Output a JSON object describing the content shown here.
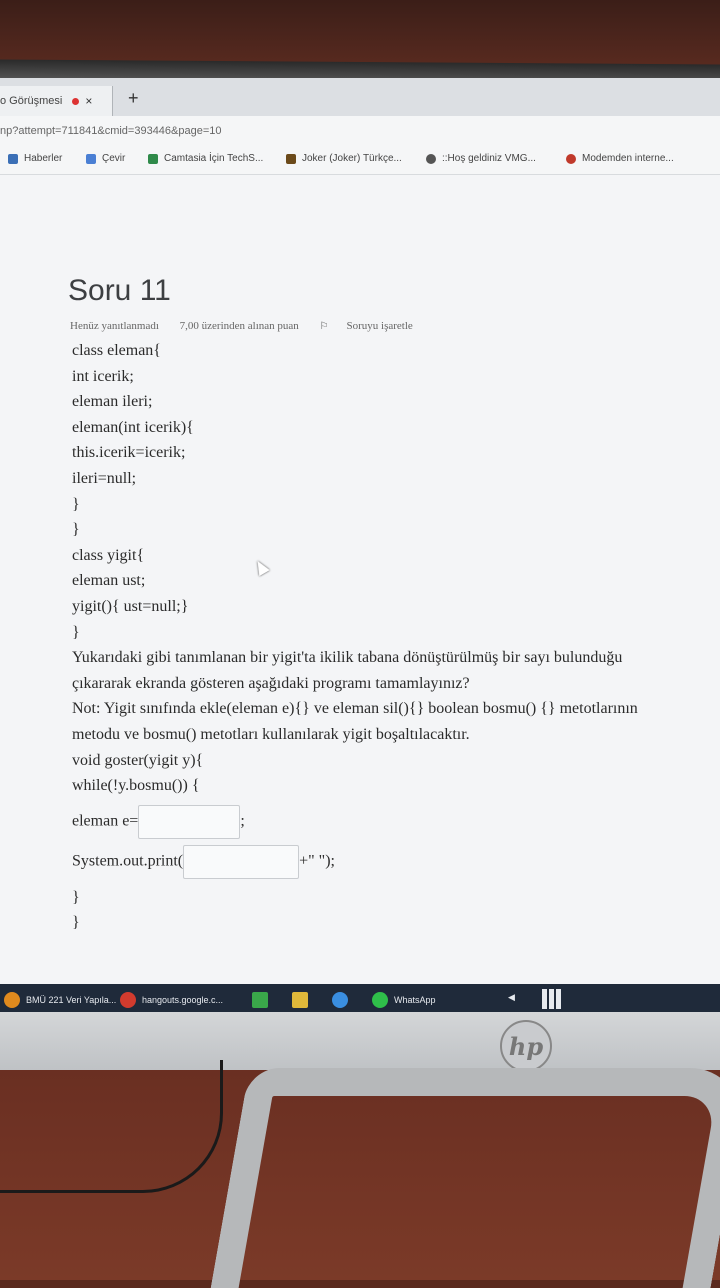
{
  "browser": {
    "tab_title": "o Görüşmesi",
    "tab_close": "×",
    "new_tab": "+",
    "url": "np?attempt=711841&cmid=393446&page=10",
    "bookmarks": [
      {
        "label": "Haberler",
        "icon": "news-icon",
        "color": "#3b6fb6"
      },
      {
        "label": "Çevir",
        "icon": "translate-icon",
        "color": "#4a7fd4"
      },
      {
        "label": "Camtasia İçin TechS...",
        "icon": "camtasia-icon",
        "color": "#2f8a4a"
      },
      {
        "label": "Joker (Joker) Türkçe...",
        "icon": "joker-icon",
        "color": "#6b4a1a"
      },
      {
        "label": "::Hoş geldiniz VMG...",
        "icon": "globe-icon",
        "color": "#555555"
      },
      {
        "label": "Modemden interne...",
        "icon": "chrome-icon",
        "color": "#c0392b"
      }
    ]
  },
  "question": {
    "title": "Soru 11",
    "status": "Henüz yanıtlanmadı",
    "points": "7,00 üzerinden alınan puan",
    "flag_label": "Soruyu işaretle",
    "code_lines": [
      "class eleman{",
      "int icerik;",
      "eleman ileri;",
      "eleman(int icerik){",
      "this.icerik=icerik;",
      "ileri=null;",
      "}",
      "}",
      "class yigit{",
      "eleman ust;",
      "yigit(){ ust=null;}",
      "}",
      "Yukarıdaki gibi tanımlanan bir yigit'ta ikilik tabana dönüştürülmüş bir sayı bulunduğu",
      "çıkararak ekranda gösteren aşağıdaki programı tamamlayınız?",
      "Not: Yigit sınıfında ekle(eleman e){} ve eleman sil(){} boolean bosmu() {} metotlarının",
      "metodu ve bosmu() metotları kullanılarak yigit boşaltılacaktır.",
      "void goster(yigit y){",
      "while(!y.bosmu()) {"
    ],
    "answer1_prefix": "eleman e=",
    "answer1_suffix": ";",
    "answer1_value": "",
    "answer2_prefix": "System.out.print(",
    "answer2_suffix": "+\" \");",
    "answer2_value": "",
    "closing_lines": [
      "}",
      "}"
    ]
  },
  "taskbar": {
    "items": [
      {
        "label": "BMÜ 221 Veri Yapıla...",
        "icon": "app-icon",
        "color": "#e08a1e"
      },
      {
        "label": "hangouts.google.c...",
        "icon": "chrome-icon",
        "color": "#d23b2e"
      },
      {
        "label": "",
        "icon": "camtasia-icon",
        "color": "#3aa84a"
      },
      {
        "label": "",
        "icon": "app-z-icon",
        "color": "#e0b83a"
      },
      {
        "label": "",
        "icon": "telegram-icon",
        "color": "#3a8ee0"
      },
      {
        "label": "WhatsApp",
        "icon": "whatsapp-icon",
        "color": "#2fbf4a"
      }
    ]
  }
}
